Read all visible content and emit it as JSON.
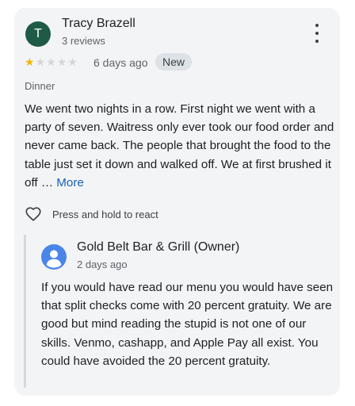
{
  "review": {
    "avatar_initial": "T",
    "avatar_color": "#1e5a45",
    "reviewer_name": "Tracy Brazell",
    "review_count": "3 reviews",
    "rating": 1,
    "rating_max": 5,
    "star_filled_color": "#f6b400",
    "star_empty_color": "#d6d6d6",
    "date": "6 days ago",
    "badge": "New",
    "meal_type": "Dinner",
    "text": "We went two nights in a row. First night we went with a party of seven. Waitress only ever took our food order and never came back. The people that brought the food to the table just set it down and walked off. We at first brushed it off …",
    "more_label": "More",
    "more_menu_icon": "more-vert-icon",
    "react_icon": "heart-outline-icon",
    "react_label": "Press and hold to react"
  },
  "owner_reply": {
    "avatar_icon": "person-icon",
    "owner_name": "Gold Belt Bar & Grill (Owner)",
    "date": "2 days ago",
    "text": "If you would have read our menu you would have seen that split checks come with 20 percent gratuity. We are good but mind reading the stupid is not one of our skills. Venmo, cashapp, and Apple Pay all exist. You could have avoided the 20 percent gratuity."
  },
  "colors": {
    "card_background": "#f3f4f6",
    "link": "#1a5fb4",
    "badge_background": "#dde2e6"
  }
}
